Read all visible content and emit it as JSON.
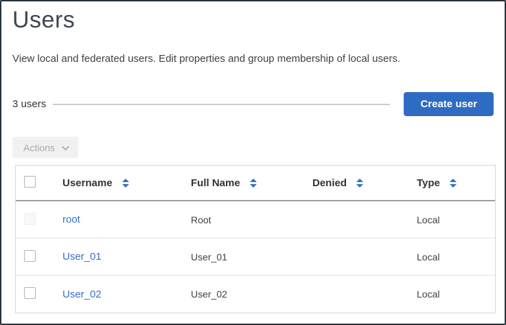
{
  "page": {
    "title": "Users",
    "description": "View local and federated users. Edit properties and group membership of local users.",
    "users_count": "3 users"
  },
  "toolbar": {
    "create_user_label": "Create user",
    "actions_label": "Actions"
  },
  "table": {
    "columns": [
      {
        "label": "Username"
      },
      {
        "label": "Full Name"
      },
      {
        "label": "Denied"
      },
      {
        "label": "Type"
      }
    ],
    "rows": [
      {
        "username": "root",
        "full_name": "Root",
        "denied": "",
        "type": "Local"
      },
      {
        "username": "User_01",
        "full_name": "User_01",
        "denied": "",
        "type": "Local"
      },
      {
        "username": "User_02",
        "full_name": "User_02",
        "denied": "",
        "type": "Local"
      }
    ]
  },
  "colors": {
    "primary_button": "#2e6bc2",
    "link": "#3a6fc8",
    "sort_icon": "#2f6fc8",
    "title_text": "#3e4650",
    "body_text": "#404040",
    "disabled_text": "#a9a9a9",
    "window_frame": "#25303b"
  }
}
